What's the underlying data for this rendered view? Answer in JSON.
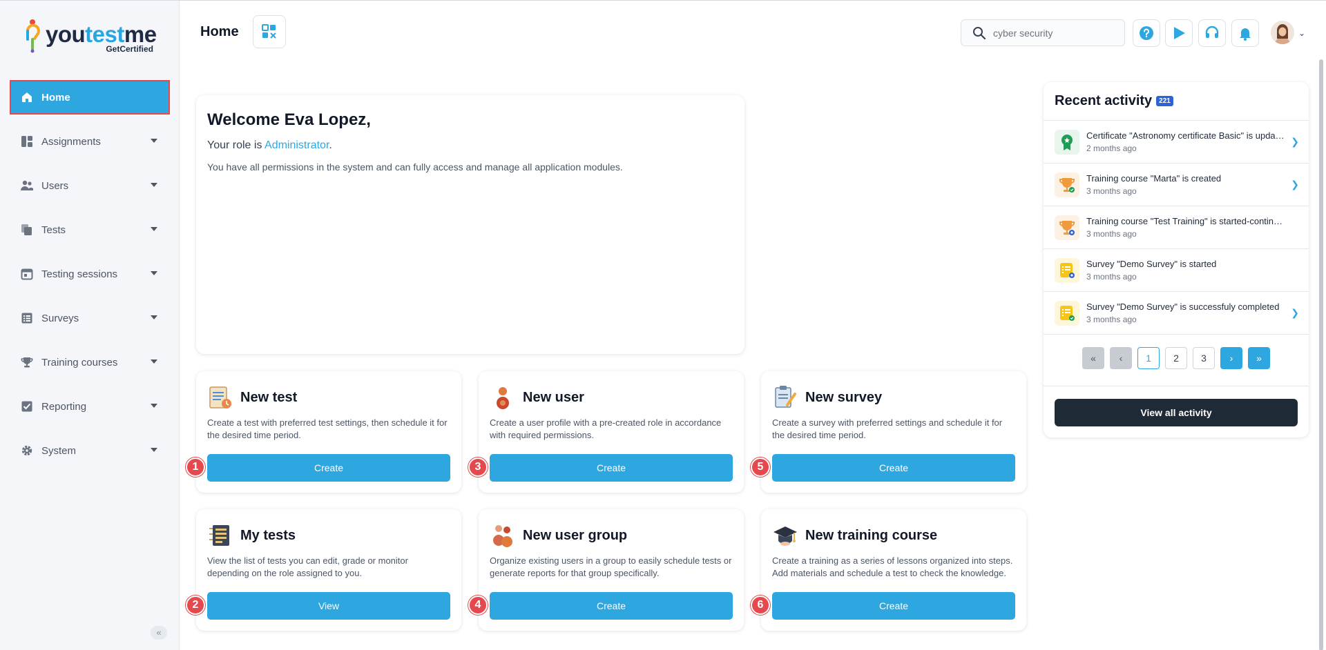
{
  "brand": {
    "word_part1": "you",
    "word_part2": "test",
    "word_part3": "me",
    "tagline": "GetCertified"
  },
  "sidebar": {
    "items": [
      {
        "label": "Home",
        "icon": "home-icon",
        "active": true
      },
      {
        "label": "Assignments",
        "icon": "dashboard-icon"
      },
      {
        "label": "Users",
        "icon": "users-icon"
      },
      {
        "label": "Tests",
        "icon": "tests-icon"
      },
      {
        "label": "Testing sessions",
        "icon": "calendar-icon"
      },
      {
        "label": "Surveys",
        "icon": "list-icon"
      },
      {
        "label": "Training courses",
        "icon": "trophy-icon"
      },
      {
        "label": "Reporting",
        "icon": "report-icon"
      },
      {
        "label": "System",
        "icon": "gear-icon"
      }
    ],
    "collapse_glyph": "«"
  },
  "header": {
    "title": "Home",
    "search_value": "cyber security",
    "avatar_caret": "⌄"
  },
  "welcome": {
    "greeting": "Welcome Eva Lopez,",
    "role_prefix": "Your role is ",
    "role": "Administrator",
    "role_suffix": ".",
    "description": "You have all permissions in the system and can fully access and manage all application modules."
  },
  "actions": [
    {
      "title": "New test",
      "text": "Create a test with preferred test settings, then schedule it for the desired time period.",
      "button": "Create",
      "badge": "1"
    },
    {
      "title": "New user",
      "text": "Create a user profile with a pre-created role in accordance with required permissions.",
      "button": "Create",
      "badge": "3"
    },
    {
      "title": "New survey",
      "text": "Create a survey with preferred settings and schedule it for the desired time period.",
      "button": "Create",
      "badge": "5"
    },
    {
      "title": "My tests",
      "text": "View the list of tests you can edit, grade or monitor depending on the role assigned to you.",
      "button": "View",
      "badge": "2"
    },
    {
      "title": "New user group",
      "text": "Organize existing users in a group to easily schedule tests or generate reports for that group specifically.",
      "button": "Create",
      "badge": "4"
    },
    {
      "title": "New training course",
      "text": "Create a training as a series of lessons organized into steps. Add materials and schedule a test to check the knowledge.",
      "button": "Create",
      "badge": "6"
    }
  ],
  "activity": {
    "title": "Recent activity",
    "count": "221",
    "items": [
      {
        "text": "Certificate \"Astronomy certificate Basic\" is updated",
        "time": "2 months ago",
        "icon": "certificate-icon"
      },
      {
        "text": "Training course \"Marta\" is created",
        "time": "3 months ago",
        "icon": "trophy-icon"
      },
      {
        "text": "Training course \"Test Training\" is started-continued",
        "time": "3 months ago",
        "icon": "trophy-icon"
      },
      {
        "text": "Survey \"Demo Survey\" is started",
        "time": "3 months ago",
        "icon": "survey-icon"
      },
      {
        "text": "Survey \"Demo Survey\" is successfuly completed",
        "time": "3 months ago",
        "icon": "survey-icon"
      }
    ],
    "pager": {
      "first": "«",
      "prev": "‹",
      "pages": [
        "1",
        "2",
        "3"
      ],
      "next": "›",
      "last": "»"
    },
    "view_all": "View all activity"
  },
  "colors": {
    "accent": "#2ea7e0",
    "badge": "#e5484d",
    "dark": "#1f2a37",
    "count_badge": "#2e63d8"
  }
}
